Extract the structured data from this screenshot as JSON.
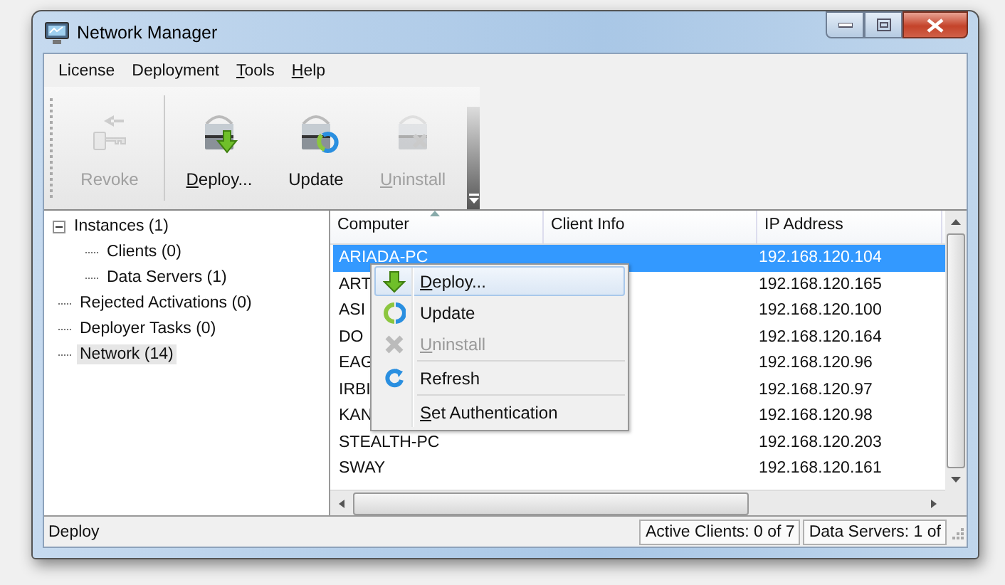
{
  "window": {
    "title": "Network Manager"
  },
  "menu_bar": [
    {
      "label": "License",
      "mnemonic": false
    },
    {
      "label": "Deployment",
      "mnemonic": false
    },
    {
      "label": "Tools",
      "mnemonic": true
    },
    {
      "label": "Help",
      "mnemonic": true
    }
  ],
  "toolbar": [
    {
      "label": "Revoke",
      "kind": "revoke",
      "disabled": true,
      "mnemonic": false
    },
    {
      "label": "Deploy...",
      "kind": "deploy",
      "disabled": false,
      "mnemonic": true
    },
    {
      "label": "Update",
      "kind": "update",
      "disabled": false,
      "mnemonic": false
    },
    {
      "label": "Uninstall",
      "kind": "uninstall",
      "disabled": true,
      "mnemonic": true
    }
  ],
  "tree": [
    {
      "label": "Instances (1)",
      "expanded": true,
      "selected": false,
      "children": [
        {
          "label": "Clients (0)",
          "selected": false
        },
        {
          "label": "Data Servers (1)",
          "selected": false
        }
      ]
    },
    {
      "label": "Rejected Activations (0)",
      "selected": false
    },
    {
      "label": "Deployer Tasks (0)",
      "selected": false
    },
    {
      "label": "Network (14)",
      "selected": true
    }
  ],
  "table": {
    "columns": [
      "Computer",
      "Client Info",
      "IP Address"
    ],
    "rows": [
      {
        "computer": "ARIADA-PC",
        "ip": "192.168.120.104",
        "selected": true
      },
      {
        "computer": "ART",
        "ip": "192.168.120.165",
        "selected": false
      },
      {
        "computer": "ASI",
        "ip": "192.168.120.100",
        "selected": false
      },
      {
        "computer": "DO",
        "ip": "192.168.120.164",
        "selected": false
      },
      {
        "computer": "EAG",
        "ip": "192.168.120.96",
        "selected": false
      },
      {
        "computer": "IRBI",
        "ip": "192.168.120.97",
        "selected": false
      },
      {
        "computer": "KAN",
        "ip": "192.168.120.98",
        "selected": false
      },
      {
        "computer": "STEALTH-PC",
        "ip": "192.168.120.203",
        "selected": false
      },
      {
        "computer": "SWAY",
        "ip": "192.168.120.161",
        "selected": false
      }
    ]
  },
  "context_menu": [
    {
      "kind": "deploy",
      "label": "Deploy...",
      "mnemonic": true,
      "disabled": false,
      "selected": true
    },
    {
      "kind": "update",
      "label": "Update",
      "mnemonic": false,
      "disabled": false,
      "selected": false
    },
    {
      "kind": "uninstall",
      "label": "Uninstall",
      "mnemonic": true,
      "disabled": true,
      "selected": false
    },
    {
      "kind": "separator"
    },
    {
      "kind": "refresh",
      "label": "Refresh",
      "mnemonic": false,
      "disabled": false,
      "selected": false
    },
    {
      "kind": "separator"
    },
    {
      "kind": "plain",
      "label": "Set Authentication",
      "mnemonic": true,
      "disabled": false,
      "selected": false
    }
  ],
  "status_bar": {
    "message": "Deploy",
    "active_clients": "Active Clients: 0 of 7",
    "data_servers": "Data Servers: 1 of"
  }
}
